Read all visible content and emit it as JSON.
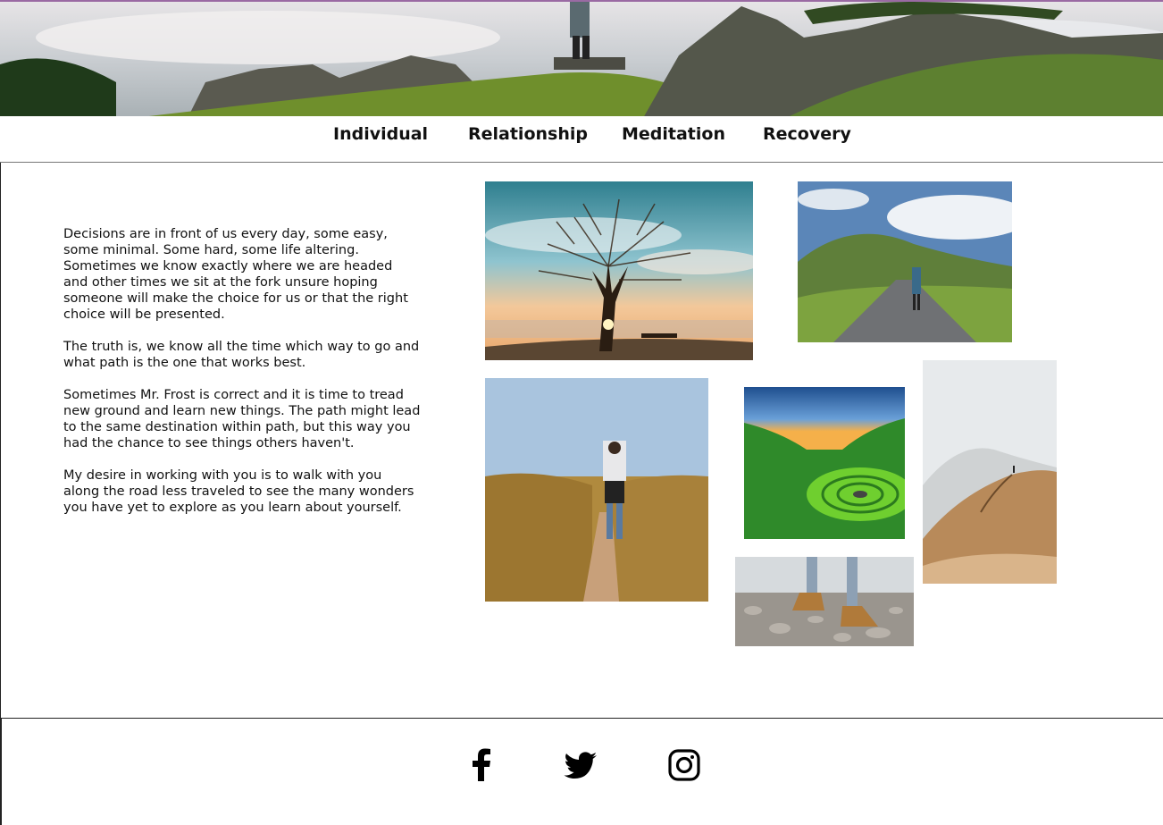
{
  "hero": {
    "icon": "mountain-landscape-banner"
  },
  "nav": {
    "items": [
      {
        "label": "Individual"
      },
      {
        "label": "Relationship"
      },
      {
        "label": "Meditation"
      },
      {
        "label": "Recovery"
      }
    ]
  },
  "content": {
    "paragraphs": [
      "Decisions are in front of us every day, some easy, some minimal. Some hard, some life altering. Sometimes we know exactly where we are headed and other times we sit at the fork unsure hoping someone will make the choice for us or that the right choice will be presented.",
      "The truth is, we know all the time which way to go and what path is the one that works best.",
      "Sometimes Mr. Frost is correct and it is time to tread new ground and learn new things. The path might lead to the same destination within path, but this way you had the chance to see things others haven't.",
      "My desire in working with you is to walk with you along the road less traveled to see the many wonders you have yet to explore as you learn about yourself."
    ]
  },
  "gallery": {
    "photos": [
      {
        "icon": "tree-sunset-photo"
      },
      {
        "icon": "road-valley-photo"
      },
      {
        "icon": "wheat-field-path-photo"
      },
      {
        "icon": "green-valley-spiral-photo"
      },
      {
        "icon": "misty-mountain-ridge-photo"
      },
      {
        "icon": "rocky-beach-boots-photo"
      }
    ]
  },
  "footer": {
    "social": [
      {
        "icon": "facebook-icon"
      },
      {
        "icon": "twitter-icon"
      },
      {
        "icon": "instagram-icon"
      }
    ]
  },
  "colors": {
    "text": "#111111",
    "rule": "#222222",
    "hero_border": "#9a6aa3"
  }
}
